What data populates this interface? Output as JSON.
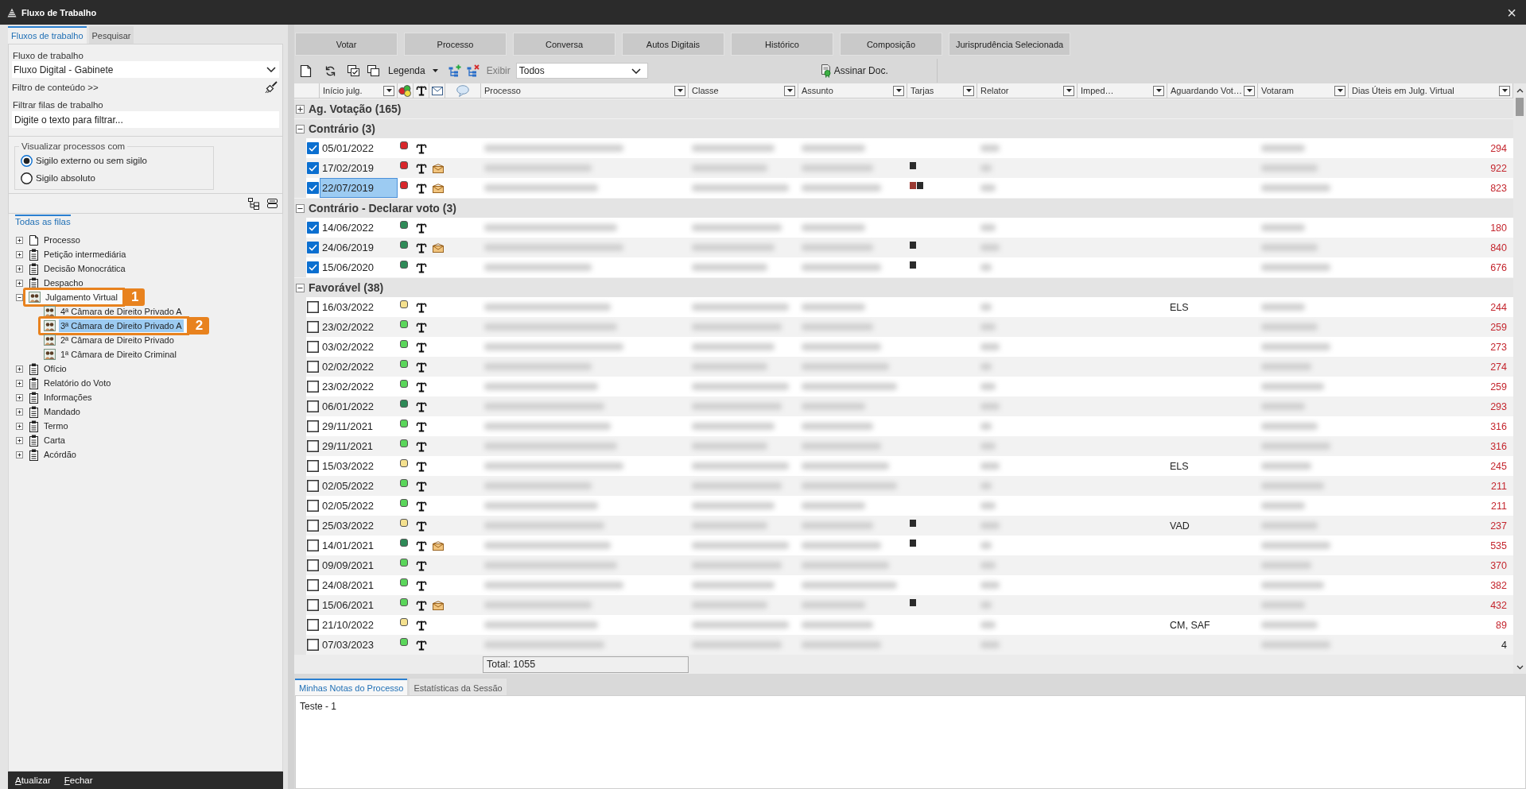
{
  "window": {
    "title": "Fluxo de Trabalho",
    "close": "×"
  },
  "left_panel": {
    "tabs": [
      {
        "label": "Fluxos de trabalho",
        "selected": true
      },
      {
        "label": "Pesquisar",
        "selected": false
      }
    ],
    "workflow": {
      "label": "Fluxo de trabalho",
      "value": "Fluxo Digital - Gabinete"
    },
    "content_filter": "Filtro de conteúdo >>",
    "queue_filter": {
      "label": "Filtrar filas de trabalho",
      "placeholder": "Digite o texto para filtrar..."
    },
    "visibility": {
      "legend": "Visualizar processos com",
      "options": [
        {
          "label": "Sigilo externo ou sem sigilo",
          "selected": true
        },
        {
          "label": "Sigilo absoluto",
          "selected": false
        }
      ]
    },
    "tree_tab": "Todas as filas",
    "tree": [
      {
        "label": "Processo",
        "kind": "document",
        "expanded": false,
        "selected": false
      },
      {
        "label": "Petição intermediária",
        "kind": "clipboard",
        "expanded": false,
        "selected": false
      },
      {
        "label": "Decisão Monocrática",
        "kind": "clipboard",
        "expanded": false,
        "selected": false
      },
      {
        "label": "Despacho",
        "kind": "clipboard",
        "expanded": false,
        "selected": false
      },
      {
        "label": "Julgamento Virtual",
        "kind": "people",
        "expanded": true,
        "selected": false,
        "callout": "1",
        "children": [
          {
            "label": "4ª Câmara de Direito Privado A",
            "kind": "people",
            "selected": false
          },
          {
            "label": "3ª Câmara de Direito Privado A",
            "kind": "people",
            "selected": true,
            "callout": "2"
          },
          {
            "label": "2ª Câmara de Direito Privado",
            "kind": "people",
            "selected": false
          },
          {
            "label": "1ª Câmara de Direito Criminal",
            "kind": "people",
            "selected": false
          }
        ]
      },
      {
        "label": "Ofício",
        "kind": "clipboard",
        "expanded": false,
        "selected": false
      },
      {
        "label": "Relatório do Voto",
        "kind": "clipboard",
        "expanded": false,
        "selected": false
      },
      {
        "label": "Informações",
        "kind": "clipboard",
        "expanded": false,
        "selected": false
      },
      {
        "label": "Mandado",
        "kind": "clipboard",
        "expanded": false,
        "selected": false
      },
      {
        "label": "Termo",
        "kind": "clipboard",
        "expanded": false,
        "selected": false
      },
      {
        "label": "Carta",
        "kind": "clipboard",
        "expanded": false,
        "selected": false
      },
      {
        "label": "Acórdão",
        "kind": "clipboard",
        "expanded": false,
        "selected": false
      }
    ],
    "footer_buttons": [
      "Atualizar",
      "Fechar"
    ]
  },
  "actions": [
    "Votar",
    "Processo",
    "Conversa",
    "Autos Digitais",
    "Histórico",
    "Composição",
    "Jurisprudência Selecionada"
  ],
  "toolbar": {
    "legend": "Legenda",
    "show_label": "Exibir",
    "show_value": "Todos",
    "sign": "Assinar Doc."
  },
  "table": {
    "columns": [
      "Início julg.",
      "Processo",
      "Classe",
      "Assunto",
      "Tarjas",
      "Relator",
      "Imped…",
      "Aguardando Vot…",
      "Votaram",
      "Dias Úteis em Julg. Virtual"
    ],
    "groups": [
      {
        "label": "Ag. Votação (165)",
        "expanded": false
      },
      {
        "label": "Contrário (3)",
        "expanded": true,
        "rows": [
          {
            "date": "05/01/2022",
            "checked": true,
            "selected": false,
            "status": {
              "color": "#d9262b"
            },
            "message": false,
            "days": "294",
            "alert": true
          },
          {
            "date": "17/02/2019",
            "checked": true,
            "selected": false,
            "status": {
              "color": "#d9262b"
            },
            "message": true,
            "tarjas": [
              {
                "color": "#2b2b2b"
              }
            ],
            "days": "922",
            "alert": true
          },
          {
            "date": "22/07/2019",
            "checked": true,
            "selected": true,
            "status": {
              "color": "#d9262b"
            },
            "message": true,
            "tarjas": [
              {
                "color": "#9b3a33"
              },
              {
                "color": "#2b2b2b"
              }
            ],
            "days": "823",
            "alert": true
          }
        ]
      },
      {
        "label": "Contrário - Declarar voto (3)",
        "expanded": true,
        "rows": [
          {
            "date": "14/06/2022",
            "checked": true,
            "selected": false,
            "status": {
              "color": "#2e8a57"
            },
            "message": false,
            "days": "180",
            "alert": true
          },
          {
            "date": "24/06/2019",
            "checked": true,
            "selected": false,
            "status": {
              "color": "#2e8a57"
            },
            "message": true,
            "tarjas": [
              {
                "color": "#2b2b2b"
              }
            ],
            "days": "840",
            "alert": true
          },
          {
            "date": "15/06/2020",
            "checked": true,
            "selected": false,
            "status": {
              "color": "#2e8a57"
            },
            "message": false,
            "tarjas": [
              {
                "color": "#2b2b2b"
              }
            ],
            "days": "676",
            "alert": true
          }
        ]
      },
      {
        "label": "Favorável (38)",
        "expanded": true,
        "rows": [
          {
            "date": "16/03/2022",
            "checked": false,
            "selected": false,
            "status": {
              "color": "#f4e08e"
            },
            "message": false,
            "awaiting": "ELS",
            "days": "244",
            "alert": true
          },
          {
            "date": "23/02/2022",
            "checked": false,
            "selected": false,
            "status": {
              "color": "#5bd65b"
            },
            "message": false,
            "days": "259",
            "alert": true
          },
          {
            "date": "03/02/2022",
            "checked": false,
            "selected": false,
            "status": {
              "color": "#5bd65b"
            },
            "message": false,
            "days": "273",
            "alert": true
          },
          {
            "date": "02/02/2022",
            "checked": false,
            "selected": false,
            "status": {
              "color": "#5bd65b"
            },
            "message": false,
            "days": "274",
            "alert": true
          },
          {
            "date": "23/02/2022",
            "checked": false,
            "selected": false,
            "status": {
              "color": "#5bd65b"
            },
            "message": false,
            "days": "259",
            "alert": true
          },
          {
            "date": "06/01/2022",
            "checked": false,
            "selected": false,
            "status": {
              "color": "#2e8a57"
            },
            "message": false,
            "days": "293",
            "alert": true
          },
          {
            "date": "29/11/2021",
            "checked": false,
            "selected": false,
            "status": {
              "color": "#5bd65b"
            },
            "message": false,
            "days": "316",
            "alert": true
          },
          {
            "date": "29/11/2021",
            "checked": false,
            "selected": false,
            "status": {
              "color": "#5bd65b"
            },
            "message": false,
            "days": "316",
            "alert": true
          },
          {
            "date": "15/03/2022",
            "checked": false,
            "selected": false,
            "status": {
              "color": "#f4e08e"
            },
            "message": false,
            "awaiting": "ELS",
            "days": "245",
            "alert": true
          },
          {
            "date": "02/05/2022",
            "checked": false,
            "selected": false,
            "status": {
              "color": "#5bd65b"
            },
            "message": false,
            "days": "211",
            "alert": true
          },
          {
            "date": "02/05/2022",
            "checked": false,
            "selected": false,
            "status": {
              "color": "#5bd65b"
            },
            "message": false,
            "days": "211",
            "alert": true
          },
          {
            "date": "25/03/2022",
            "checked": false,
            "selected": false,
            "status": {
              "color": "#f4e08e"
            },
            "message": false,
            "tarjas": [
              {
                "color": "#2b2b2b"
              }
            ],
            "awaiting": "VAD",
            "days": "237",
            "alert": true
          },
          {
            "date": "14/01/2021",
            "checked": false,
            "selected": false,
            "status": {
              "color": "#2e8a57"
            },
            "message": true,
            "tarjas": [
              {
                "color": "#2b2b2b"
              }
            ],
            "days": "535",
            "alert": true
          },
          {
            "date": "09/09/2021",
            "checked": false,
            "selected": false,
            "status": {
              "color": "#5bd65b"
            },
            "message": false,
            "days": "370",
            "alert": true
          },
          {
            "date": "24/08/2021",
            "checked": false,
            "selected": false,
            "status": {
              "color": "#5bd65b"
            },
            "message": false,
            "days": "382",
            "alert": true
          },
          {
            "date": "15/06/2021",
            "checked": false,
            "selected": false,
            "status": {
              "color": "#5bd65b"
            },
            "message": true,
            "tarjas": [
              {
                "color": "#2b2b2b"
              }
            ],
            "days": "432",
            "alert": true
          },
          {
            "date": "21/10/2022",
            "checked": false,
            "selected": false,
            "status": {
              "color": "#f4e08e"
            },
            "message": false,
            "awaiting": "CM, SAF",
            "days": "89",
            "alert": true
          },
          {
            "date": "07/03/2023",
            "checked": false,
            "selected": false,
            "status": {
              "color": "#5bd65b"
            },
            "message": false,
            "days": "4",
            "alert": false
          }
        ]
      }
    ],
    "total": "Total: 1055"
  },
  "notes": {
    "tabs": [
      {
        "label": "Minhas Notas do Processo",
        "selected": true
      },
      {
        "label": "Estatísticas da Sessão",
        "selected": false
      }
    ],
    "text": "Teste - 1"
  }
}
